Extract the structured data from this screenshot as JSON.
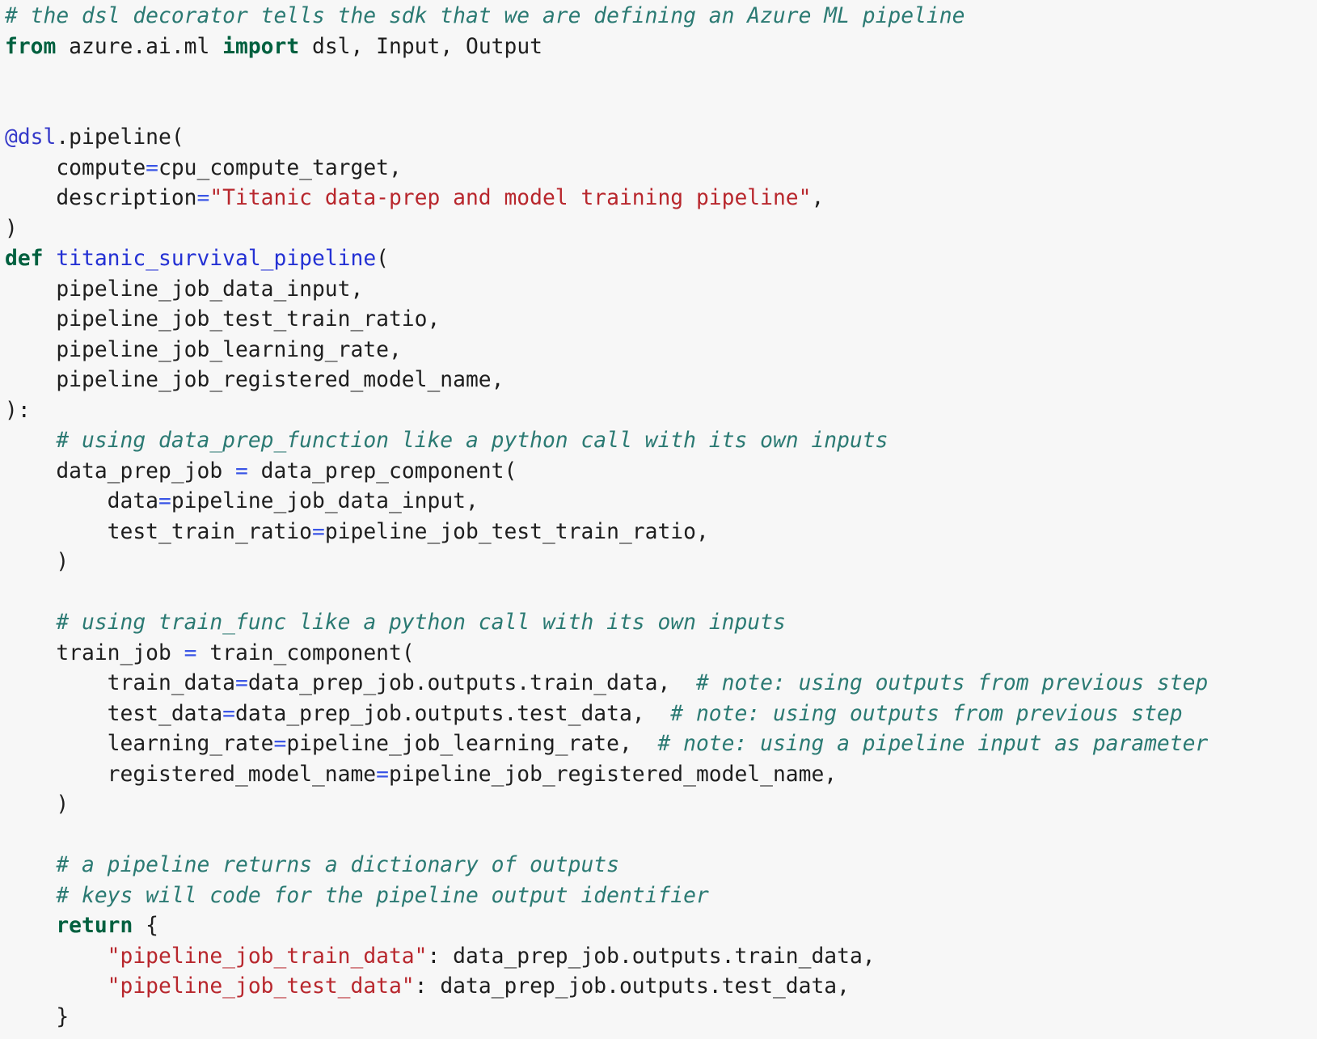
{
  "colors": {
    "background": "#f7f7f7",
    "text": "#1e1e1e",
    "comment": "#2b7a73",
    "keyword": "#00603f",
    "string": "#b8272d",
    "decorator": "#3539c9",
    "function_name": "#2431d4",
    "operator": "#3a55e6"
  },
  "code": {
    "lines": [
      [
        {
          "t": "comment",
          "v": "# the dsl decorator tells the sdk that we are defining an Azure ML pipeline"
        }
      ],
      [
        {
          "t": "keyword",
          "v": "from"
        },
        {
          "t": "plain",
          "v": " azure.ai.ml "
        },
        {
          "t": "keyword",
          "v": "import"
        },
        {
          "t": "plain",
          "v": " dsl, Input, Output"
        }
      ],
      [],
      [],
      [
        {
          "t": "decorator",
          "v": "@dsl"
        },
        {
          "t": "plain",
          "v": ".pipeline("
        }
      ],
      [
        {
          "t": "plain",
          "v": "    compute"
        },
        {
          "t": "op",
          "v": "="
        },
        {
          "t": "plain",
          "v": "cpu_compute_target,"
        }
      ],
      [
        {
          "t": "plain",
          "v": "    description"
        },
        {
          "t": "op",
          "v": "="
        },
        {
          "t": "string",
          "v": "\"Titanic data-prep and model training pipeline\""
        },
        {
          "t": "plain",
          "v": ","
        }
      ],
      [
        {
          "t": "plain",
          "v": ")"
        }
      ],
      [
        {
          "t": "keyword",
          "v": "def"
        },
        {
          "t": "plain",
          "v": " "
        },
        {
          "t": "funcname",
          "v": "titanic_survival_pipeline"
        },
        {
          "t": "plain",
          "v": "("
        }
      ],
      [
        {
          "t": "plain",
          "v": "    pipeline_job_data_input,"
        }
      ],
      [
        {
          "t": "plain",
          "v": "    pipeline_job_test_train_ratio,"
        }
      ],
      [
        {
          "t": "plain",
          "v": "    pipeline_job_learning_rate,"
        }
      ],
      [
        {
          "t": "plain",
          "v": "    pipeline_job_registered_model_name,"
        }
      ],
      [
        {
          "t": "plain",
          "v": "):"
        }
      ],
      [
        {
          "t": "plain",
          "v": "    "
        },
        {
          "t": "comment",
          "v": "# using data_prep_function like a python call with its own inputs"
        }
      ],
      [
        {
          "t": "plain",
          "v": "    data_prep_job "
        },
        {
          "t": "op",
          "v": "="
        },
        {
          "t": "plain",
          "v": " data_prep_component("
        }
      ],
      [
        {
          "t": "plain",
          "v": "        data"
        },
        {
          "t": "op",
          "v": "="
        },
        {
          "t": "plain",
          "v": "pipeline_job_data_input,"
        }
      ],
      [
        {
          "t": "plain",
          "v": "        test_train_ratio"
        },
        {
          "t": "op",
          "v": "="
        },
        {
          "t": "plain",
          "v": "pipeline_job_test_train_ratio,"
        }
      ],
      [
        {
          "t": "plain",
          "v": "    )"
        }
      ],
      [],
      [
        {
          "t": "plain",
          "v": "    "
        },
        {
          "t": "comment",
          "v": "# using train_func like a python call with its own inputs"
        }
      ],
      [
        {
          "t": "plain",
          "v": "    train_job "
        },
        {
          "t": "op",
          "v": "="
        },
        {
          "t": "plain",
          "v": " train_component("
        }
      ],
      [
        {
          "t": "plain",
          "v": "        train_data"
        },
        {
          "t": "op",
          "v": "="
        },
        {
          "t": "plain",
          "v": "data_prep_job.outputs.train_data,  "
        },
        {
          "t": "comment",
          "v": "# note: using outputs from previous step"
        }
      ],
      [
        {
          "t": "plain",
          "v": "        test_data"
        },
        {
          "t": "op",
          "v": "="
        },
        {
          "t": "plain",
          "v": "data_prep_job.outputs.test_data,  "
        },
        {
          "t": "comment",
          "v": "# note: using outputs from previous step"
        }
      ],
      [
        {
          "t": "plain",
          "v": "        learning_rate"
        },
        {
          "t": "op",
          "v": "="
        },
        {
          "t": "plain",
          "v": "pipeline_job_learning_rate,  "
        },
        {
          "t": "comment",
          "v": "# note: using a pipeline input as parameter"
        }
      ],
      [
        {
          "t": "plain",
          "v": "        registered_model_name"
        },
        {
          "t": "op",
          "v": "="
        },
        {
          "t": "plain",
          "v": "pipeline_job_registered_model_name,"
        }
      ],
      [
        {
          "t": "plain",
          "v": "    )"
        }
      ],
      [],
      [
        {
          "t": "plain",
          "v": "    "
        },
        {
          "t": "comment",
          "v": "# a pipeline returns a dictionary of outputs"
        }
      ],
      [
        {
          "t": "plain",
          "v": "    "
        },
        {
          "t": "comment",
          "v": "# keys will code for the pipeline output identifier"
        }
      ],
      [
        {
          "t": "plain",
          "v": "    "
        },
        {
          "t": "keyword",
          "v": "return"
        },
        {
          "t": "plain",
          "v": " {"
        }
      ],
      [
        {
          "t": "plain",
          "v": "        "
        },
        {
          "t": "string",
          "v": "\"pipeline_job_train_data\""
        },
        {
          "t": "plain",
          "v": ": data_prep_job.outputs.train_data,"
        }
      ],
      [
        {
          "t": "plain",
          "v": "        "
        },
        {
          "t": "string",
          "v": "\"pipeline_job_test_data\""
        },
        {
          "t": "plain",
          "v": ": data_prep_job.outputs.test_data,"
        }
      ],
      [
        {
          "t": "plain",
          "v": "    }"
        }
      ]
    ]
  }
}
